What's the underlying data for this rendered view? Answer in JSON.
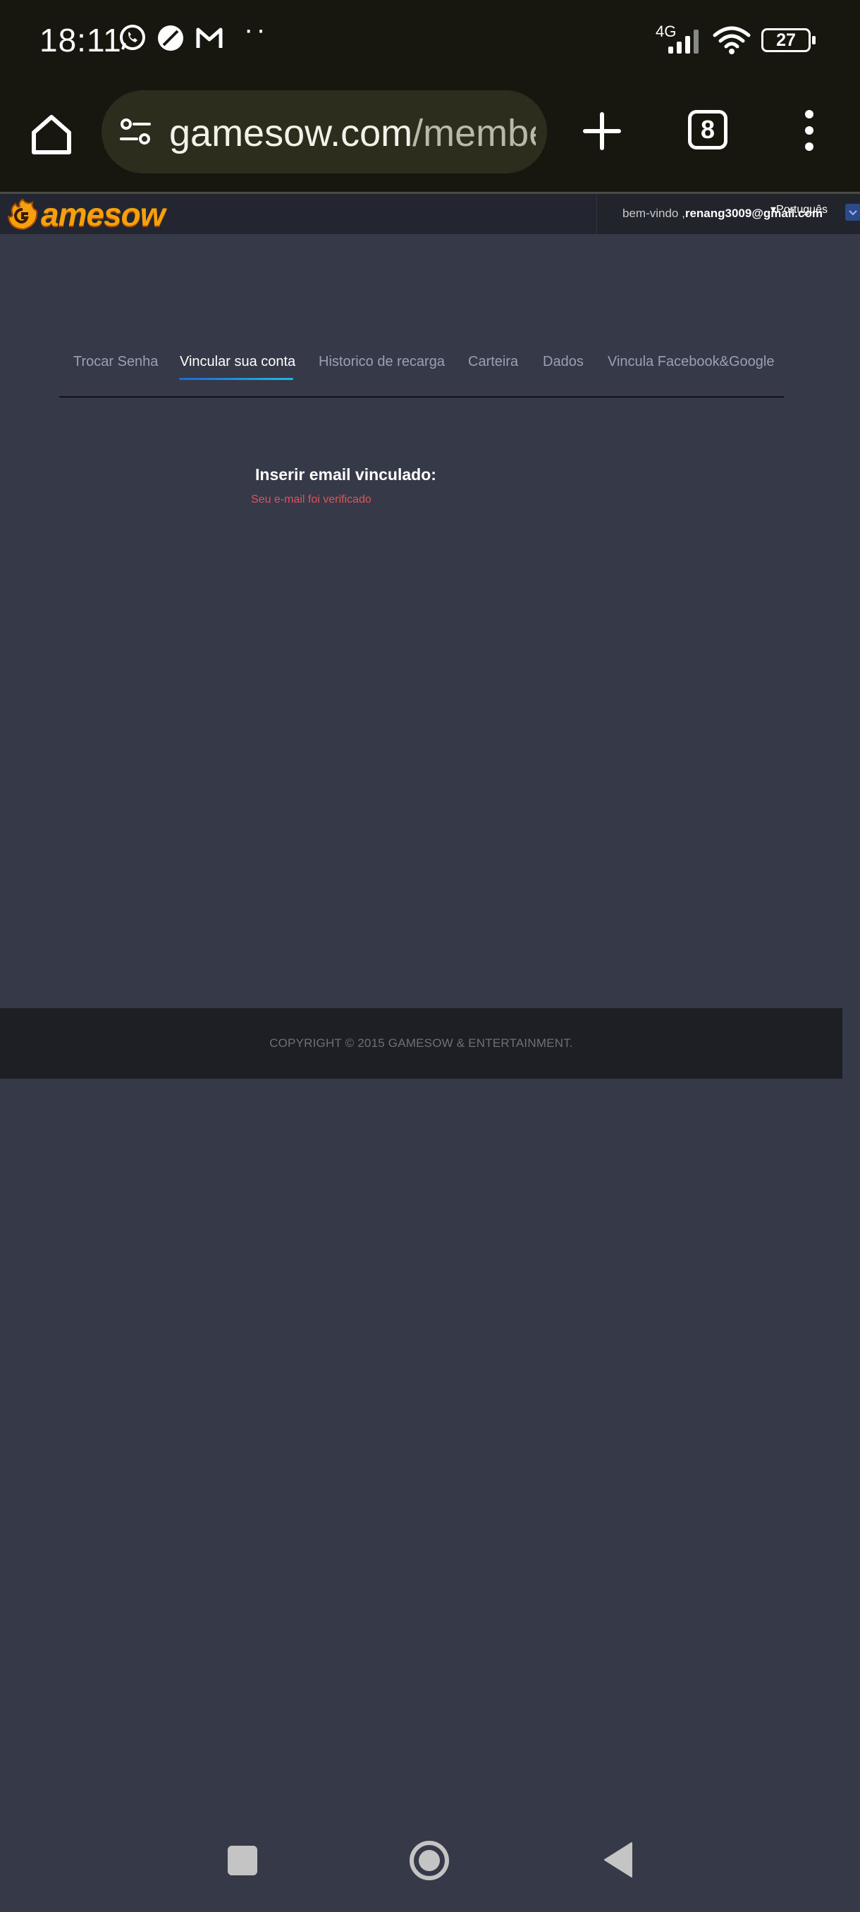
{
  "status_bar": {
    "time": "18:11",
    "network_label": "4G",
    "battery_level": "27",
    "icons": [
      "whatsapp-icon",
      "app-circle-icon",
      "gmail-icon",
      "more-dots-icon",
      "signal-icon",
      "wifi-icon",
      "battery-icon"
    ]
  },
  "browser": {
    "url_domain": "gamesow.com",
    "url_path": "/member/",
    "tab_count": "8"
  },
  "header": {
    "logo_text": "amesow",
    "welcome_prefix": "bem-vindo ,",
    "user_email": "renang3009@gmail.com",
    "language": "Português"
  },
  "tabs": [
    {
      "label": "Trocar Senha",
      "active": false
    },
    {
      "label": "Vincular sua conta",
      "active": true
    },
    {
      "label": "Historico de recarga",
      "active": false
    },
    {
      "label": "Carteira",
      "active": false
    },
    {
      "label": "Dados",
      "active": false
    },
    {
      "label": "Vincula Facebook&Google",
      "active": false
    }
  ],
  "content": {
    "title": "Inserir email vinculado:",
    "status": "Seu e-mail foi verificado"
  },
  "footer": {
    "copyright": "COPYRIGHT © 2015 GAMESOW & ENTERTAINMENT."
  },
  "colors": {
    "page_bg": "#363a48",
    "toolbar_bg": "#171710",
    "accent": "#1a8fe0",
    "status_red": "#e0525a",
    "logo_orange": "#f6a00c"
  }
}
